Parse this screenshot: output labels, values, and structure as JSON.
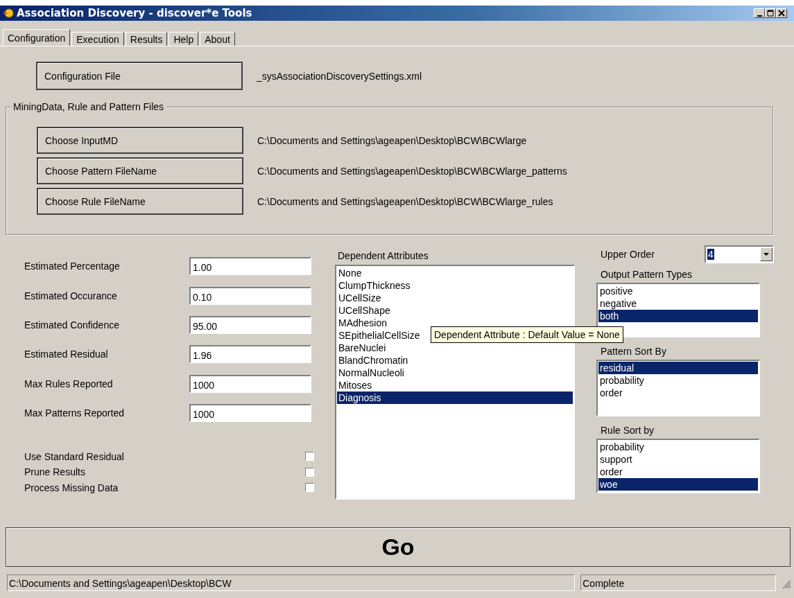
{
  "window": {
    "title": "Association Discovery - discover*e Tools"
  },
  "tabs": [
    {
      "label": "Configuration",
      "selected": true
    },
    {
      "label": "Execution",
      "selected": false
    },
    {
      "label": "Results",
      "selected": false
    },
    {
      "label": "Help",
      "selected": false
    },
    {
      "label": "About",
      "selected": false
    }
  ],
  "configuration_file": {
    "button": "Configuration File",
    "value": "_sysAssociationDiscoverySettings.xml"
  },
  "files_group": {
    "legend": "MiningData, Rule and Pattern Files",
    "rows": [
      {
        "button": "Choose InputMD",
        "value": "C:\\Documents and Settings\\ageapen\\Desktop\\BCW\\BCWlarge"
      },
      {
        "button": "Choose Pattern FileName",
        "value": "C:\\Documents and Settings\\ageapen\\Desktop\\BCW\\BCWlarge_patterns"
      },
      {
        "button": "Choose Rule FileName",
        "value": "C:\\Documents and Settings\\ageapen\\Desktop\\BCW\\BCWlarge_rules"
      }
    ]
  },
  "parameters": [
    {
      "label": "Estimated Percentage",
      "value": "1.00"
    },
    {
      "label": "Estimated Occurance",
      "value": "0.10"
    },
    {
      "label": "Estimated Confidence",
      "value": "95.00"
    },
    {
      "label": "Estimated Residual",
      "value": "1.96"
    },
    {
      "label": "Max Rules Reported",
      "value": "1000"
    },
    {
      "label": "Max Patterns Reported",
      "value": "1000"
    }
  ],
  "options": [
    {
      "label": "Use Standard Residual",
      "checked": false
    },
    {
      "label": "Prune Results",
      "checked": false
    },
    {
      "label": "Process Missing Data",
      "checked": false
    }
  ],
  "dependent_attributes": {
    "label": "Dependent Attributes",
    "items": [
      {
        "label": "None",
        "selected": false
      },
      {
        "label": "ClumpThickness",
        "selected": false
      },
      {
        "label": "UCellSize",
        "selected": false
      },
      {
        "label": "UCellShape",
        "selected": false
      },
      {
        "label": "MAdhesion",
        "selected": false
      },
      {
        "label": "SEpithelialCellSize",
        "selected": false
      },
      {
        "label": "BareNuclei",
        "selected": false
      },
      {
        "label": "BlandChromatin",
        "selected": false
      },
      {
        "label": "NormalNucleoli",
        "selected": false
      },
      {
        "label": "Mitoses",
        "selected": false
      },
      {
        "label": "Diagnosis",
        "selected": true
      }
    ]
  },
  "upper_order": {
    "label": "Upper Order",
    "value": "4"
  },
  "output_pattern_types": {
    "label": "Output Pattern Types",
    "items": [
      {
        "label": "positive",
        "selected": false
      },
      {
        "label": "negative",
        "selected": false
      },
      {
        "label": "both",
        "selected": true
      }
    ]
  },
  "pattern_sort_by": {
    "label": "Pattern Sort By",
    "items": [
      {
        "label": "residual",
        "selected": true
      },
      {
        "label": "probability",
        "selected": false
      },
      {
        "label": "order",
        "selected": false
      }
    ]
  },
  "rule_sort_by": {
    "label": "Rule Sort by",
    "items": [
      {
        "label": "probability",
        "selected": false
      },
      {
        "label": "support",
        "selected": false
      },
      {
        "label": "order",
        "selected": false
      },
      {
        "label": "woe",
        "selected": true
      }
    ]
  },
  "tooltip": "Dependent Attribute : Default Value = None",
  "go_button": "Go",
  "status_bar": [
    "C:\\Documents and Settings\\ageapen\\Desktop\\BCW",
    "Complete"
  ]
}
